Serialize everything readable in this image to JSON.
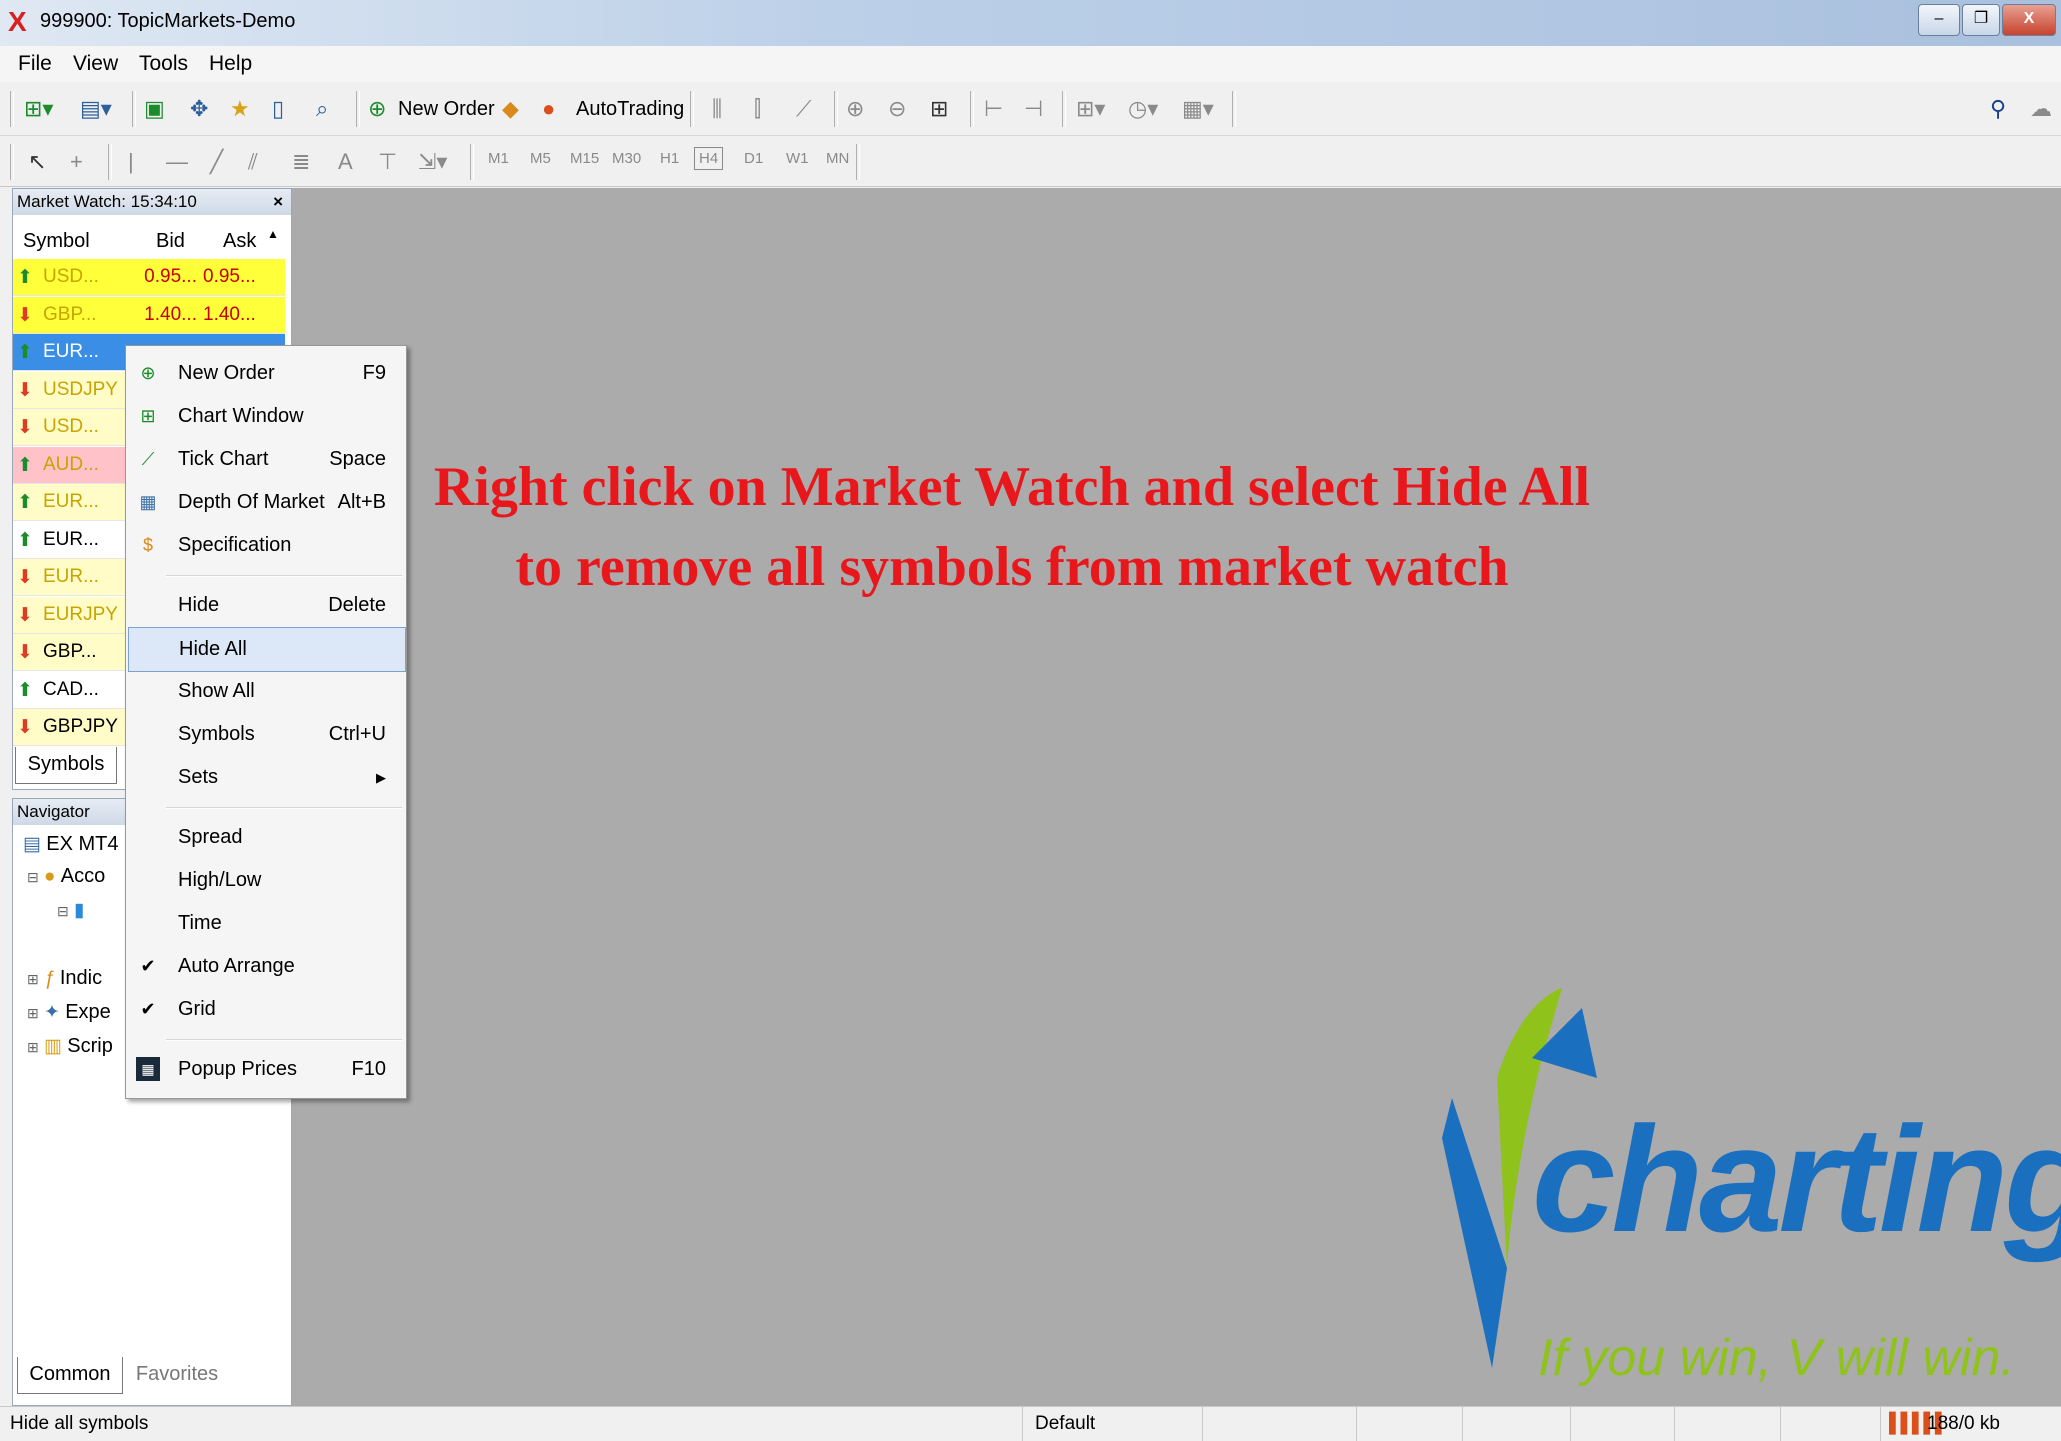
{
  "window": {
    "title": "999900: TopicMarkets-Demo"
  },
  "menu": [
    "File",
    "View",
    "Tools",
    "Help"
  ],
  "toolbar": {
    "new_order": "New Order",
    "autotrading": "AutoTrading",
    "timeframes": [
      "M1",
      "M5",
      "M15",
      "M30",
      "H1",
      "H4",
      "D1",
      "W1",
      "MN"
    ],
    "text_tool": "A"
  },
  "market_watch": {
    "title": "Market Watch: 15:34:10",
    "close": "×",
    "columns": [
      "Symbol",
      "Bid",
      "Ask"
    ],
    "rows": [
      {
        "symbol": "USD...",
        "bid": "0.95...",
        "ask": "0.95...",
        "dir": "up"
      },
      {
        "symbol": "GBP...",
        "bid": "1.40...",
        "ask": "1.40...",
        "dir": "down"
      },
      {
        "symbol": "EUR...",
        "bid": "",
        "ask": "",
        "dir": "up"
      },
      {
        "symbol": "USDJPY",
        "bid": "",
        "ask": "",
        "dir": "down"
      },
      {
        "symbol": "USD...",
        "bid": "",
        "ask": "",
        "dir": "down"
      },
      {
        "symbol": "AUD...",
        "bid": "",
        "ask": "",
        "dir": "up"
      },
      {
        "symbol": "EUR...",
        "bid": "",
        "ask": "",
        "dir": "up"
      },
      {
        "symbol": "EUR...",
        "bid": "",
        "ask": "",
        "dir": "up"
      },
      {
        "symbol": "EUR...",
        "bid": "",
        "ask": "",
        "dir": "down"
      },
      {
        "symbol": "EURJPY",
        "bid": "",
        "ask": "",
        "dir": "down"
      },
      {
        "symbol": "GBP...",
        "bid": "",
        "ask": "",
        "dir": "down"
      },
      {
        "symbol": "CAD...",
        "bid": "",
        "ask": "",
        "dir": "up"
      },
      {
        "symbol": "GBPJPY",
        "bid": "",
        "ask": "",
        "dir": "down"
      }
    ],
    "tab": "Symbols"
  },
  "navigator": {
    "title": "Navigator",
    "items": [
      "EX MT4",
      "Acco",
      "Indic",
      "Expe",
      "Scrip"
    ],
    "tabs": [
      "Common",
      "Favorites"
    ]
  },
  "context_menu": {
    "items": [
      {
        "label": "New Order",
        "key": "F9"
      },
      {
        "label": "Chart Window",
        "key": ""
      },
      {
        "label": "Tick Chart",
        "key": "Space"
      },
      {
        "label": "Depth Of Market",
        "key": "Alt+B"
      },
      {
        "label": "Specification",
        "key": ""
      },
      {
        "label": "Hide",
        "key": "Delete"
      },
      {
        "label": "Hide All",
        "key": ""
      },
      {
        "label": "Show All",
        "key": ""
      },
      {
        "label": "Symbols",
        "key": "Ctrl+U"
      },
      {
        "label": "Sets",
        "key": ""
      },
      {
        "label": "Spread",
        "key": ""
      },
      {
        "label": "High/Low",
        "key": ""
      },
      {
        "label": "Time",
        "key": ""
      },
      {
        "label": "Auto Arrange",
        "key": ""
      },
      {
        "label": "Grid",
        "key": ""
      },
      {
        "label": "Popup Prices",
        "key": "F10"
      }
    ]
  },
  "annotation": {
    "line1": "Right click on Market Watch and select Hide All",
    "line2": "to remove all symbols from market watch"
  },
  "logo": {
    "text": "charting",
    "tagline": "If you win, V will win."
  },
  "status": {
    "left": "Hide all symbols",
    "profile": "Default",
    "traffic": "188/0 kb"
  },
  "colors": {
    "annotation": "#e8171b",
    "chart_bg": "#ababab",
    "logo_blue": "#1a6fbf",
    "logo_green": "#8fc21a"
  }
}
